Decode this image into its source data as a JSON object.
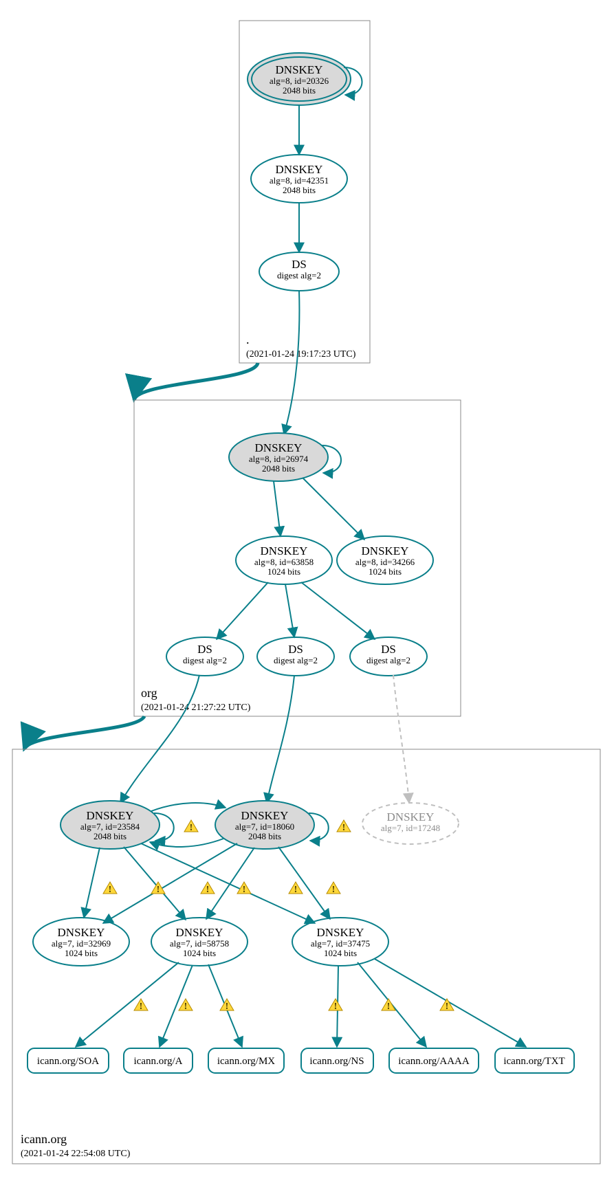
{
  "zones": {
    "root": {
      "name": ".",
      "date": "(2021-01-24 19:17:23 UTC)"
    },
    "org": {
      "name": "org",
      "date": "(2021-01-24 21:27:22 UTC)"
    },
    "icann": {
      "name": "icann.org",
      "date": "(2021-01-24 22:54:08 UTC)"
    }
  },
  "nodes": {
    "root_ksk": {
      "title": "DNSKEY",
      "l1": "alg=8, id=20326",
      "l2": "2048 bits"
    },
    "root_zsk": {
      "title": "DNSKEY",
      "l1": "alg=8, id=42351",
      "l2": "2048 bits"
    },
    "root_ds": {
      "title": "DS",
      "l1": "digest alg=2"
    },
    "org_ksk": {
      "title": "DNSKEY",
      "l1": "alg=8, id=26974",
      "l2": "2048 bits"
    },
    "org_zsk1": {
      "title": "DNSKEY",
      "l1": "alg=8, id=63858",
      "l2": "1024 bits"
    },
    "org_zsk2": {
      "title": "DNSKEY",
      "l1": "alg=8, id=34266",
      "l2": "1024 bits"
    },
    "org_ds1": {
      "title": "DS",
      "l1": "digest alg=2"
    },
    "org_ds2": {
      "title": "DS",
      "l1": "digest alg=2"
    },
    "org_ds3": {
      "title": "DS",
      "l1": "digest alg=2"
    },
    "ic_ksk1": {
      "title": "DNSKEY",
      "l1": "alg=7, id=23584",
      "l2": "2048 bits"
    },
    "ic_ksk2": {
      "title": "DNSKEY",
      "l1": "alg=7, id=18060",
      "l2": "2048 bits"
    },
    "ic_ksk_miss": {
      "title": "DNSKEY",
      "l1": "alg=7, id=17248"
    },
    "ic_zsk1": {
      "title": "DNSKEY",
      "l1": "alg=7, id=32969",
      "l2": "1024 bits"
    },
    "ic_zsk2": {
      "title": "DNSKEY",
      "l1": "alg=7, id=58758",
      "l2": "1024 bits"
    },
    "ic_zsk3": {
      "title": "DNSKEY",
      "l1": "alg=7, id=37475",
      "l2": "1024 bits"
    },
    "rr_soa": {
      "label": "icann.org/SOA"
    },
    "rr_a": {
      "label": "icann.org/A"
    },
    "rr_mx": {
      "label": "icann.org/MX"
    },
    "rr_ns": {
      "label": "icann.org/NS"
    },
    "rr_aaaa": {
      "label": "icann.org/AAAA"
    },
    "rr_txt": {
      "label": "icann.org/TXT"
    }
  }
}
